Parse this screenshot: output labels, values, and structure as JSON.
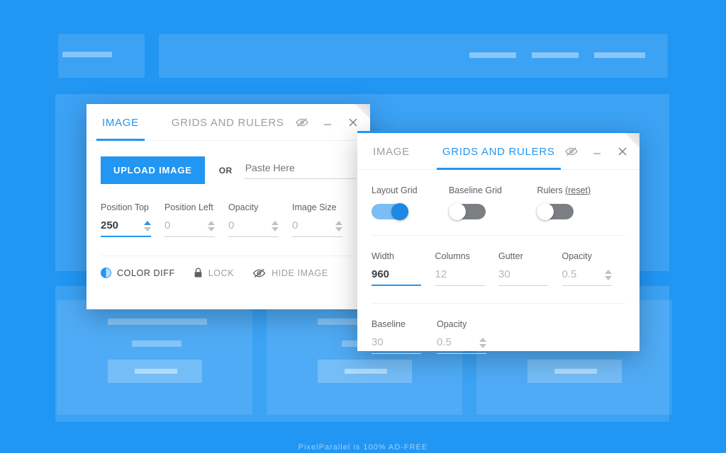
{
  "background": {
    "nav_links": 3,
    "cards": 3
  },
  "footer": {
    "note": "PixelParallel is 100% AD-FREE"
  },
  "colors": {
    "page_bg": "#2196f3",
    "accent": "#2196f3",
    "toggle_on": "#1e88e5",
    "toggle_off": "#7b7f83",
    "panel_bg": "#ffffff",
    "muted_text": "#9aa0a6"
  },
  "image_panel": {
    "tabs": [
      {
        "label": "IMAGE",
        "active": true
      },
      {
        "label": "GRIDS AND RULERS",
        "active": false
      }
    ],
    "window_controls": [
      {
        "name": "hide-eye-icon",
        "glyph": "eye-slash"
      },
      {
        "name": "minimize-icon",
        "glyph": "minimize"
      },
      {
        "name": "close-icon",
        "glyph": "close"
      }
    ],
    "upload_button": "UPLOAD IMAGE",
    "or_label": "OR",
    "paste_placeholder": "Paste Here",
    "paste_value": "",
    "fields": [
      {
        "label": "Position Top",
        "value": "250",
        "filled": true,
        "active": true,
        "spinner": true,
        "spinner_up_active": true
      },
      {
        "label": "Position Left",
        "value": "0",
        "filled": false,
        "active": false,
        "spinner": true,
        "spinner_up_active": false
      },
      {
        "label": "Opacity",
        "value": "0",
        "filled": false,
        "active": false,
        "spinner": true,
        "spinner_up_active": false
      },
      {
        "label": "Image Size",
        "value": "0",
        "filled": false,
        "active": false,
        "spinner": true,
        "spinner_up_active": false
      }
    ],
    "actions": [
      {
        "label": "COLOR DIFF",
        "icon": "contrast-icon",
        "enabled": true
      },
      {
        "label": "LOCK",
        "icon": "lock-icon",
        "enabled": false
      },
      {
        "label": "HIDE IMAGE",
        "icon": "eye-slash-icon",
        "enabled": false
      }
    ]
  },
  "grids_panel": {
    "tabs": [
      {
        "label": "IMAGE",
        "active": false
      },
      {
        "label": "GRIDS AND RULERS",
        "active": true
      }
    ],
    "window_controls": [
      {
        "name": "hide-eye-icon",
        "glyph": "eye-slash"
      },
      {
        "name": "minimize-icon",
        "glyph": "minimize"
      },
      {
        "name": "close-icon",
        "glyph": "close"
      }
    ],
    "toggles": [
      {
        "label": "Layout Grid",
        "state": "on"
      },
      {
        "label": "Baseline Grid",
        "state": "off"
      },
      {
        "label": "Rulers",
        "link": "(reset)",
        "state": "off"
      }
    ],
    "grid_fields": [
      {
        "label": "Width",
        "value": "960",
        "filled": true,
        "active": true,
        "spinner": false
      },
      {
        "label": "Columns",
        "value": "12",
        "filled": false,
        "active": false,
        "spinner": false
      },
      {
        "label": "Gutter",
        "value": "30",
        "filled": false,
        "active": false,
        "spinner": false
      },
      {
        "label": "Opacity",
        "value": "0.5",
        "filled": false,
        "active": false,
        "spinner": true
      }
    ],
    "baseline_fields": [
      {
        "label": "Baseline",
        "value": "30",
        "filled": false,
        "active": false,
        "spinner": false
      },
      {
        "label": "Opacity",
        "value": "0.5",
        "filled": false,
        "active": false,
        "spinner": true
      }
    ]
  }
}
